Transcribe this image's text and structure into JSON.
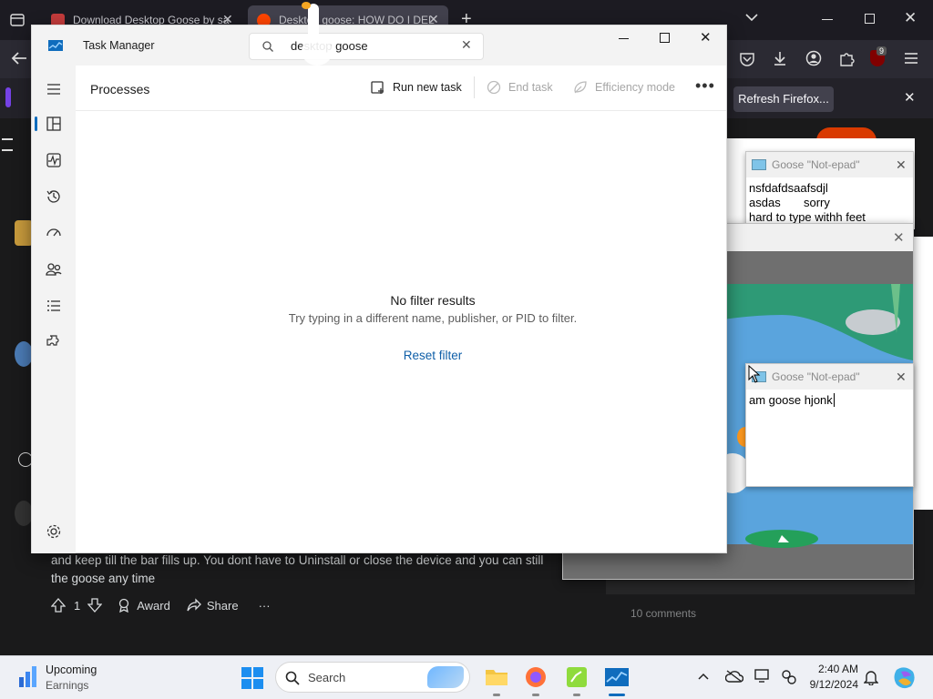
{
  "browser": {
    "tabs": [
      {
        "title": "Download Desktop Goose by sa",
        "active": false
      },
      {
        "title": "Desktop goose: HOW DO I DEL",
        "active": true
      }
    ],
    "new_tab": "+",
    "notification_label": "Refresh Firefox...",
    "extension_badge": "9"
  },
  "task_manager": {
    "title": "Task Manager",
    "search_value": "desktop goose",
    "page_title": "Processes",
    "actions": {
      "run_new_task": "Run new task",
      "end_task": "End task",
      "efficiency_mode": "Efficiency mode"
    },
    "empty_title": "No filter results",
    "empty_hint": "Try typing in a different name, publisher, or PID to filter.",
    "reset_filter": "Reset filter"
  },
  "notepad1": {
    "title": "Goose \"Not-epad\"",
    "lines": [
      "nsfdafdsaafsdjl",
      "asdas       sorry",
      "hard to type withh feet"
    ]
  },
  "notepad2": {
    "title": "Goose \"Not-epad\"",
    "text": "am goose hjonk"
  },
  "reddit": {
    "comment_line1": "and keep till the bar fills up. You dont have to Uninstall or close the device and you can still",
    "comment_line2": "the goose any time",
    "vote_count": "1",
    "award": "Award",
    "share": "Share",
    "more": "···",
    "comments": "10 comments"
  },
  "taskbar": {
    "widget_title": "Upcoming",
    "widget_subtitle": "Earnings",
    "search_placeholder": "Search",
    "time": "2:40 AM",
    "date": "9/12/2024"
  },
  "colors": {
    "accent": "#0f5fa8",
    "firefox_dark": "#2b2a33",
    "reddit_bg": "#1a1a1b",
    "pond": "#4a93d6",
    "grass": "#2f9c6b"
  }
}
